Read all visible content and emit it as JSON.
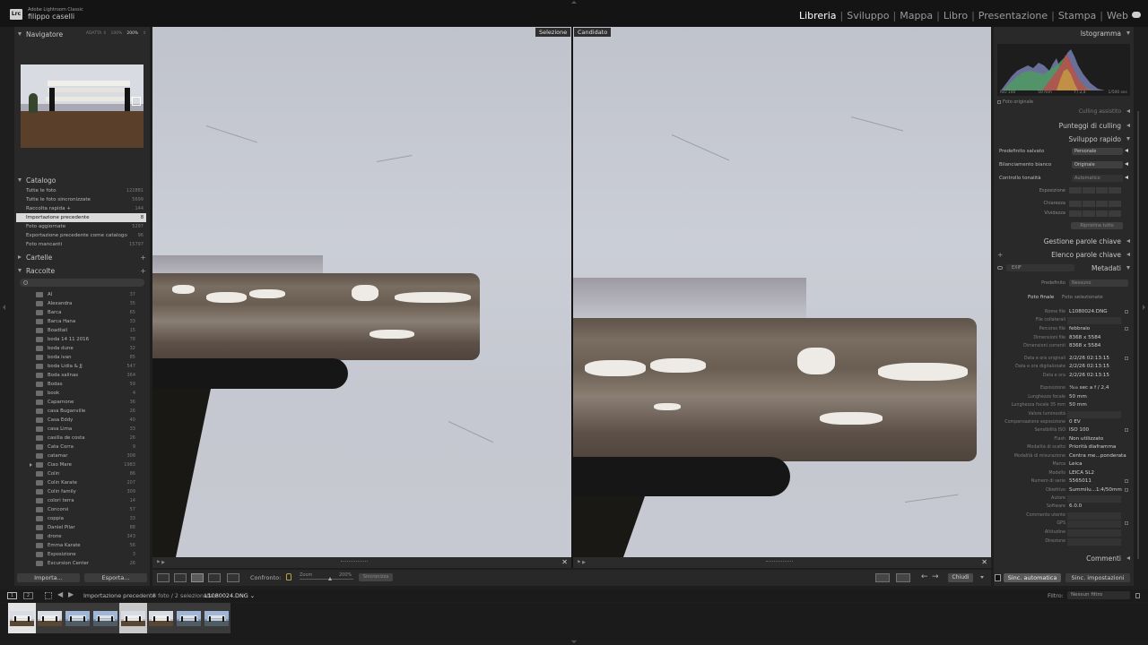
{
  "app": {
    "logo": "Lrc",
    "name": "Adobe Lightroom Classic",
    "user": "filippo caselli"
  },
  "modules": [
    {
      "label": "Libreria",
      "active": true
    },
    {
      "label": "Sviluppo",
      "active": false
    },
    {
      "label": "Mappa",
      "active": false
    },
    {
      "label": "Libro",
      "active": false
    },
    {
      "label": "Presentazione",
      "active": false
    },
    {
      "label": "Stampa",
      "active": false
    },
    {
      "label": "Web",
      "active": false
    }
  ],
  "navigator": {
    "title": "Navigatore",
    "zoom_options": [
      "ADATTA ⇕",
      "100%",
      "200%",
      "⇕"
    ],
    "active_zoom": "200%"
  },
  "catalog": {
    "title": "Catalogo",
    "items": [
      {
        "label": "Tutte le foto",
        "count": "122881"
      },
      {
        "label": "Tutte le foto sincronizzate",
        "count": "5699"
      },
      {
        "label": "Raccolta rapida +",
        "count": "144"
      },
      {
        "label": "Importazione precedente",
        "count": "8",
        "selected": true
      },
      {
        "label": "Foto aggiornate",
        "count": "5297"
      },
      {
        "label": "Esportazione precedente come catalogo",
        "count": "96"
      },
      {
        "label": "Foto mancanti",
        "count": "15797"
      }
    ]
  },
  "folders": {
    "title": "Cartelle",
    "plus": "+"
  },
  "collections": {
    "title": "Raccolte",
    "plus": "+",
    "filter_placeholder": "",
    "items": [
      {
        "label": "AI",
        "count": "37"
      },
      {
        "label": "Alexandra",
        "count": "35"
      },
      {
        "label": "Barca",
        "count": "65"
      },
      {
        "label": "Barca Hana",
        "count": "33"
      },
      {
        "label": "Boadtail",
        "count": "15"
      },
      {
        "label": "boda 14 11 2016",
        "count": "78"
      },
      {
        "label": "boda dune",
        "count": "32"
      },
      {
        "label": "boda ivan",
        "count": "85"
      },
      {
        "label": "boda Lidia & JJ",
        "count": "547"
      },
      {
        "label": "Boda salinas",
        "count": "364"
      },
      {
        "label": "Bodas",
        "count": "59"
      },
      {
        "label": "book",
        "count": "4"
      },
      {
        "label": "Caparnone",
        "count": "36"
      },
      {
        "label": "casa Buganville",
        "count": "26"
      },
      {
        "label": "Casa Eddy",
        "count": "40"
      },
      {
        "label": "casa Lima",
        "count": "33"
      },
      {
        "label": "casilla de costa",
        "count": "26"
      },
      {
        "label": "Cata Corra",
        "count": "9"
      },
      {
        "label": "catamar",
        "count": "308"
      },
      {
        "label": "Ciao Mare",
        "count": "1983",
        "expandable": true
      },
      {
        "label": "Colin",
        "count": "86"
      },
      {
        "label": "Colin Karate",
        "count": "207"
      },
      {
        "label": "Colin family",
        "count": "309"
      },
      {
        "label": "colori terra",
        "count": "14"
      },
      {
        "label": "Concorsi",
        "count": "57"
      },
      {
        "label": "coppia",
        "count": "33"
      },
      {
        "label": "Daniel Pilar",
        "count": "88"
      },
      {
        "label": "drone",
        "count": "343"
      },
      {
        "label": "Emma Karate",
        "count": "56"
      },
      {
        "label": "Esposizione",
        "count": "3"
      },
      {
        "label": "Excursion Center",
        "count": "26"
      }
    ]
  },
  "left_footer": {
    "import": "Importa...",
    "export": "Esporta..."
  },
  "compare": {
    "select_label": "Selezione",
    "candidate_label": "Candidato"
  },
  "toolbar": {
    "compare_label": "Confronto:",
    "zoom_label": "Zoom",
    "zoom_value": "200%",
    "sync_label": "Sincronizza",
    "done_label": "Chiudi"
  },
  "right": {
    "histogram_title": "Istogramma",
    "hist_info": [
      "ISO 100",
      "50 mm",
      "f / 2,4",
      "1/500 sec"
    ],
    "original_photo": "Foto originale",
    "culling_partial": "Culling assistito",
    "culling_scores": "Punteggi di culling",
    "quick_develop": "Sviluppo rapido",
    "saved_preset_label": "Predefinito salvato",
    "saved_preset_value": "Personale",
    "wb_label": "Bilanciamento bianco",
    "wb_value": "Originale",
    "tone_label": "Controllo tonalità",
    "tone_auto": "Automatico",
    "exposure_label": "Esposizione",
    "clarity_label": "Chiarezza",
    "vibrance_label": "Vividezza",
    "reset_all": "Ripristina tutto",
    "keywording": "Gestione parole chiave",
    "keyword_list": "Elenco parole chiave",
    "keyword_plus": "+",
    "metadata": "Metadati",
    "metadata_set": "EXIF",
    "preset_label": "Predefinito",
    "preset_value": "Nessuno",
    "tab_final": "Foto finale",
    "tab_selected": "Foto selezionate",
    "comments": "Commenti"
  },
  "metadata_rows": [
    {
      "k": "Nome file",
      "v": "L1080024.DNG"
    },
    {
      "k": "File collaterali",
      "v": ""
    },
    {
      "k": "Percorso file",
      "v": "febbraio"
    },
    {
      "k": "Dimensioni file",
      "v": "8368 x 5584"
    },
    {
      "k": "Dimensioni correnti",
      "v": "8368 x 5584"
    },
    {
      "k": "Data e ora originali",
      "v": "2/2/26 02:13:15"
    },
    {
      "k": "Data e ora digitalizzate",
      "v": "2/2/26 02:13:15"
    },
    {
      "k": "Data e ora",
      "v": "2/2/26 02:13:15"
    },
    {
      "k": "Esposizione",
      "v": "¹⁄₅₀₀ sec a f / 2,4"
    },
    {
      "k": "Lunghezza focale",
      "v": "50 mm"
    },
    {
      "k": "Lunghezza focale 35 mm",
      "v": "50 mm"
    },
    {
      "k": "Valore luminosità",
      "v": ""
    },
    {
      "k": "Compensazione esposizione",
      "v": "0 EV"
    },
    {
      "k": "Sensibilità ISO",
      "v": "ISO 100"
    },
    {
      "k": "Flash",
      "v": "Non utilizzato"
    },
    {
      "k": "Modalità di scatto",
      "v": "Priorità diaframma"
    },
    {
      "k": "Modalità di misurazione",
      "v": "Centra me...ponderata"
    },
    {
      "k": "Marca",
      "v": "Leica"
    },
    {
      "k": "Modello",
      "v": "LEICA SL2"
    },
    {
      "k": "Numero di serie",
      "v": "5565011"
    },
    {
      "k": "Obiettivo",
      "v": "Summilu...1:4/50mm"
    },
    {
      "k": "Autore",
      "v": ""
    },
    {
      "k": "Software",
      "v": "6.0.0"
    },
    {
      "k": "Commento utente",
      "v": ""
    },
    {
      "k": "GPS",
      "v": ""
    },
    {
      "k": "Altitudine",
      "v": ""
    },
    {
      "k": "Direzione",
      "v": ""
    }
  ],
  "right_footer": {
    "sync_auto": "Sinc. automatica",
    "sync_settings": "Sinc. impostazioni"
  },
  "filmbar": {
    "screen1": "1",
    "screen2": "2",
    "source": "Importazione precedente",
    "count": "8 foto / 2 selezionata /",
    "file": "L1080024.DNG ⌄",
    "filter_label": "Filtro:",
    "filter_value": "Nessun filtro"
  },
  "filmstrip": [
    {
      "kind": "bench",
      "state": "active"
    },
    {
      "kind": "bench",
      "state": "normal"
    },
    {
      "kind": "sky",
      "state": "normal"
    },
    {
      "kind": "sky",
      "state": "normal"
    },
    {
      "kind": "bench",
      "state": "selected"
    },
    {
      "kind": "bench",
      "state": "normal"
    },
    {
      "kind": "sky",
      "state": "normal"
    },
    {
      "kind": "sky",
      "state": "normal"
    }
  ]
}
